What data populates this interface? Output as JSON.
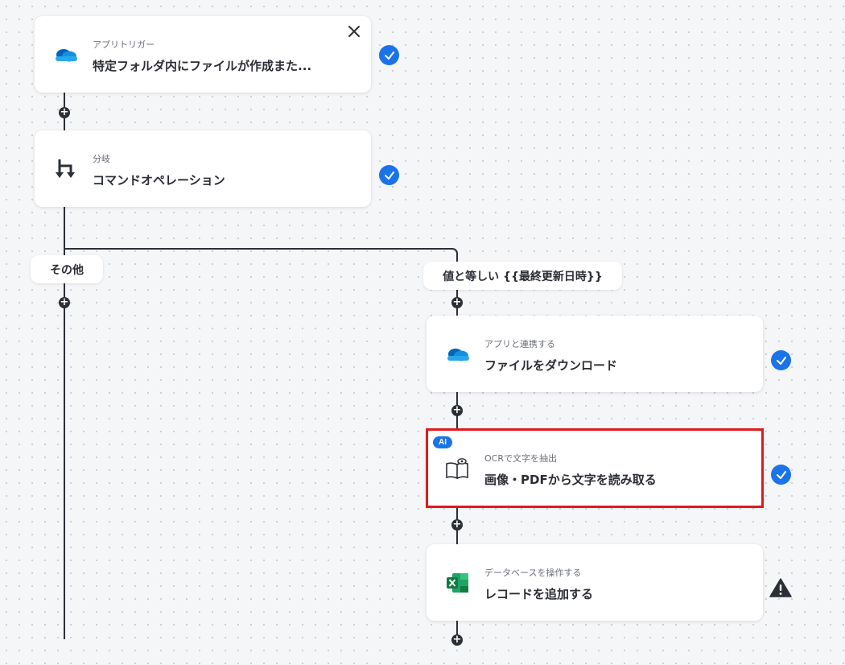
{
  "nodes": {
    "trigger": {
      "subtitle": "アプリトリガー",
      "title": "特定フォルダ内にファイルが作成また...",
      "icon": "onedrive-cloud-icon",
      "status": "complete"
    },
    "branch": {
      "subtitle": "分岐",
      "title": "コマンドオペレーション",
      "icon": "branch-icon",
      "status": "complete"
    },
    "download": {
      "subtitle": "アプリと連携する",
      "title": "ファイルをダウンロード",
      "icon": "onedrive-cloud-icon",
      "status": "complete"
    },
    "ocr": {
      "badge": "AI",
      "subtitle": "OCRで文字を抽出",
      "title": "画像・PDFから文字を読み取る",
      "icon": "ocr-book-icon",
      "status": "complete",
      "highlighted": true
    },
    "excel": {
      "subtitle": "データベースを操作する",
      "title": "レコードを追加する",
      "icon": "excel-icon",
      "status": "warning"
    }
  },
  "branches": {
    "other": "その他",
    "equals": "値と等しい {{最終更新日時}}"
  },
  "colors": {
    "accent": "#1a73e8",
    "highlight": "#e0191d",
    "connector": "#2b2f36"
  }
}
